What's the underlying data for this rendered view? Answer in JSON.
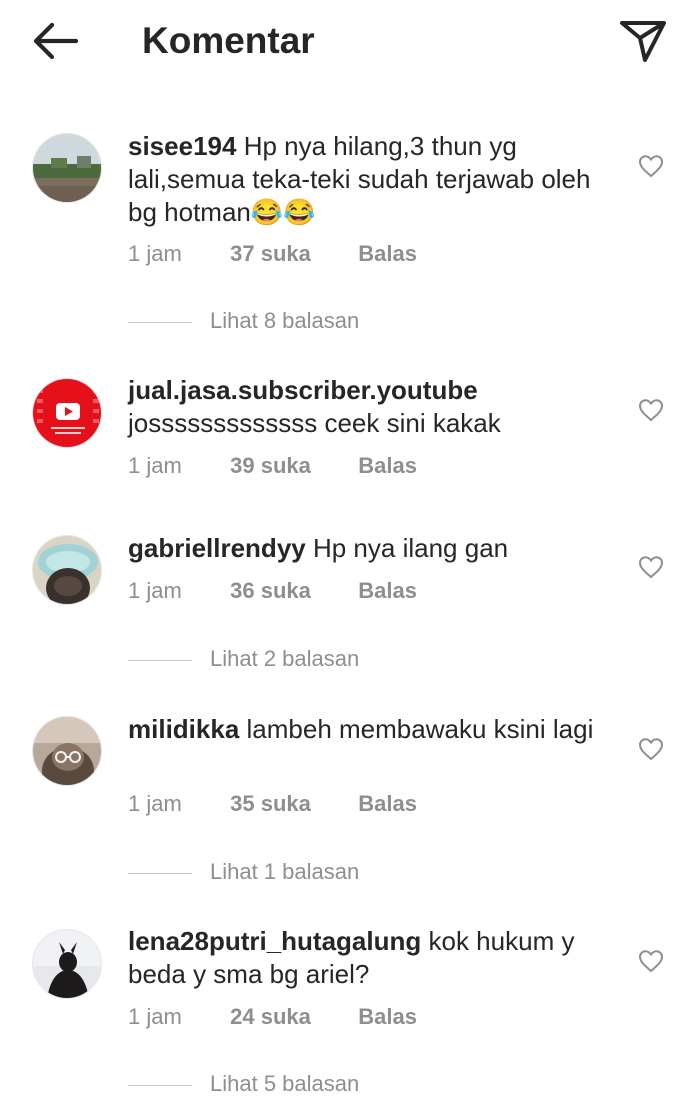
{
  "header": {
    "title": "Komentar",
    "back_icon": "arrow-left-icon",
    "share_icon": "paper-plane-icon"
  },
  "comments": [
    {
      "username": "sisee194",
      "text": "Hp nya hilang,3 thun yg lali,semua teka-teki sudah terjawab oleh bg hotman😂😂",
      "time": "1 jam",
      "likes": "37 suka",
      "reply_label": "Balas",
      "view_replies": "Lihat 8 balasan"
    },
    {
      "username": "jual.jasa.subscriber.youtube",
      "text": "josssssssssssss ceek sini kakak",
      "time": "1 jam",
      "likes": "39 suka",
      "reply_label": "Balas"
    },
    {
      "username": "gabriellrendyy",
      "text": "Hp nya ilang gan",
      "time": "1 jam",
      "likes": "36 suka",
      "reply_label": "Balas",
      "view_replies": "Lihat 2 balasan"
    },
    {
      "username": "milidikka",
      "text": "lambeh membawaku ksini lagi",
      "time": "1 jam",
      "likes": "35 suka",
      "reply_label": "Balas",
      "view_replies": "Lihat 1 balasan"
    },
    {
      "username": "lena28putri_hutagalung",
      "text": "kok hukum y beda y sma bg ariel?",
      "time": "1 jam",
      "likes": "24 suka",
      "reply_label": "Balas",
      "view_replies": "Lihat 5 balasan"
    }
  ],
  "colors": {
    "text": "#262626",
    "secondary": "#8e8e8e",
    "youtube_red": "#e5101a"
  }
}
